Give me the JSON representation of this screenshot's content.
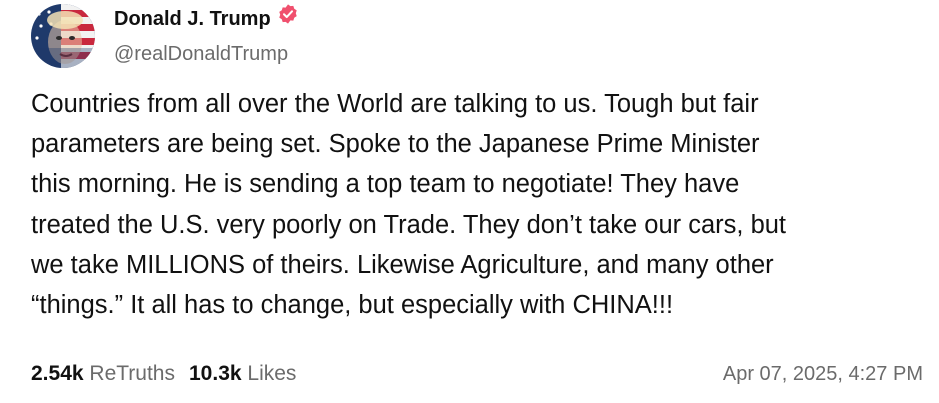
{
  "post": {
    "author": {
      "display_name": "Donald J. Trump",
      "handle": "@realDonaldTrump",
      "verified": true,
      "avatar_icon": "profile-avatar-flag-face",
      "verified_color": "#f0506e"
    },
    "body_lines": [
      "Countries from all over the World are talking to us. Tough but fair",
      "parameters are being set. Spoke to the Japanese Prime Minister",
      "this morning. He is sending a top team to negotiate! They have",
      "treated the U.S. very poorly on Trade. They don’t take our cars, but",
      "we take MILLIONS of theirs. Likewise Agriculture, and many other",
      "“things.” It all has to change, but especially with CHINA!!!"
    ],
    "stats": {
      "retruths_count": "2.54k",
      "retruths_label": "ReTruths",
      "likes_count": "10.3k",
      "likes_label": "Likes"
    },
    "timestamp": "Apr 07, 2025, 4:27 PM"
  }
}
